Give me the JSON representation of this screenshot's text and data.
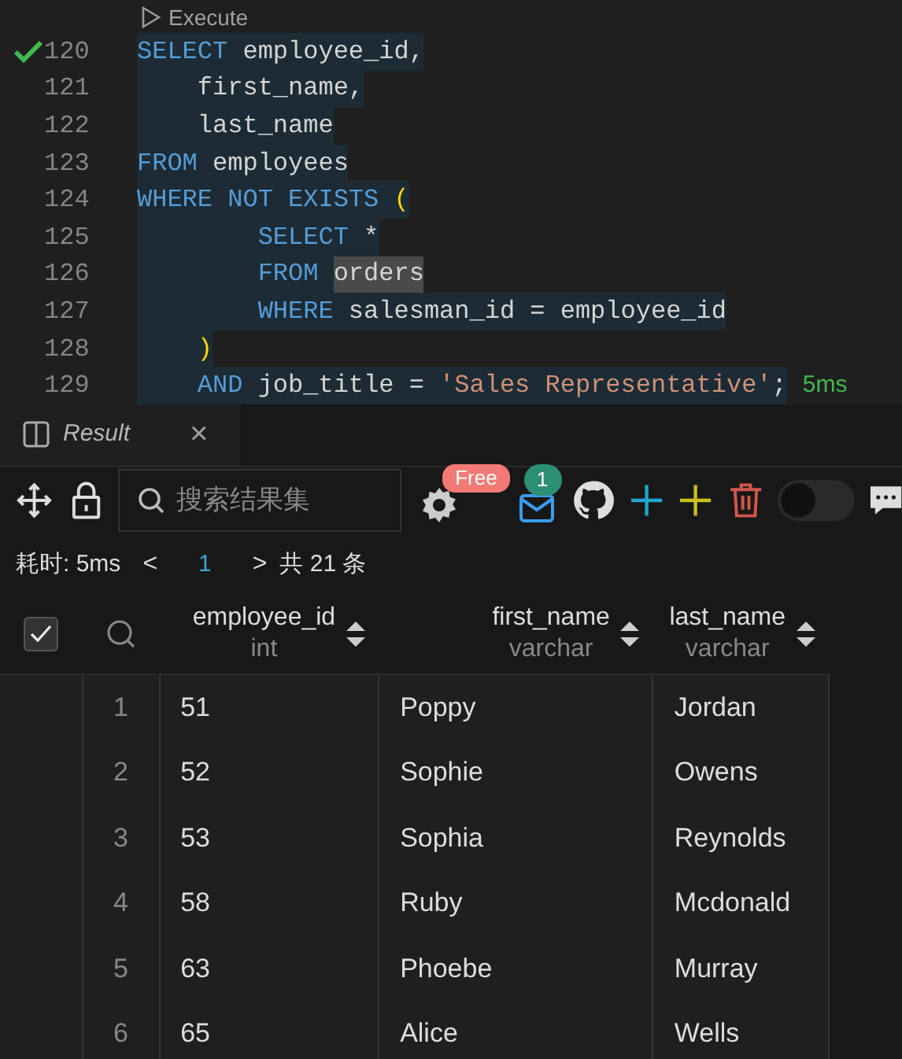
{
  "editor": {
    "codelens": "Execute",
    "lines": [
      {
        "number": "120",
        "passed": true,
        "tokens": [
          {
            "kind": "keyword",
            "text": "SELECT"
          },
          {
            "kind": "text",
            "text": " employee_id,"
          }
        ]
      },
      {
        "number": "121",
        "passed": false,
        "tokens": [
          {
            "kind": "text",
            "text": "    first_name,"
          }
        ]
      },
      {
        "number": "122",
        "passed": false,
        "tokens": [
          {
            "kind": "text",
            "text": "    last_name"
          }
        ]
      },
      {
        "number": "123",
        "passed": false,
        "tokens": [
          {
            "kind": "keyword",
            "text": "FROM"
          },
          {
            "kind": "text",
            "text": " employees"
          }
        ]
      },
      {
        "number": "124",
        "passed": false,
        "tokens": [
          {
            "kind": "keyword",
            "text": "WHERE NOT EXISTS"
          },
          {
            "kind": "paren",
            "text": " ("
          }
        ]
      },
      {
        "number": "125",
        "passed": false,
        "tokens": [
          {
            "kind": "keyword",
            "text": "        SELECT"
          },
          {
            "kind": "text",
            "text": " *"
          }
        ]
      },
      {
        "number": "126",
        "passed": false,
        "tokens": [
          {
            "kind": "keyword",
            "text": "        FROM "
          },
          {
            "kind": "match",
            "text": "orders"
          }
        ]
      },
      {
        "number": "127",
        "passed": false,
        "tokens": [
          {
            "kind": "keyword",
            "text": "        WHERE"
          },
          {
            "kind": "text",
            "text": " salesman_id = employee_id"
          }
        ]
      },
      {
        "number": "128",
        "passed": false,
        "tokens": [
          {
            "kind": "paren",
            "text": "    )"
          }
        ]
      },
      {
        "number": "129",
        "passed": false,
        "tokens": [
          {
            "kind": "keyword",
            "text": "    AND"
          },
          {
            "kind": "text",
            "text": " job_title = "
          },
          {
            "kind": "string",
            "text": "'Sales Representative'"
          },
          {
            "kind": "text",
            "text": ";"
          }
        ],
        "hint": "5ms"
      }
    ]
  },
  "panel": {
    "tabs": [
      {
        "label": "Result",
        "selected": true,
        "close": "×"
      }
    ],
    "search": {
      "placeholder": "搜索结果集"
    },
    "badges": {
      "settings": "Free",
      "mail": "1"
    },
    "toggle": {
      "on": false
    },
    "status": {
      "elapsed": "耗时: 5ms",
      "prev": "<",
      "page": "1",
      "next": ">",
      "total": "共 21 条"
    },
    "table": {
      "all_checked": true,
      "columns": [
        {
          "name": "employee_id",
          "type": "int"
        },
        {
          "name": "first_name",
          "type": "varchar"
        },
        {
          "name": "last_name",
          "type": "varchar"
        }
      ],
      "rows": [
        {
          "index": "1",
          "cells": [
            "51",
            "Poppy",
            "Jordan"
          ]
        },
        {
          "index": "2",
          "cells": [
            "52",
            "Sophie",
            "Owens"
          ]
        },
        {
          "index": "3",
          "cells": [
            "53",
            "Sophia",
            "Reynolds"
          ]
        },
        {
          "index": "4",
          "cells": [
            "58",
            "Ruby",
            "Mcdonald"
          ]
        },
        {
          "index": "5",
          "cells": [
            "63",
            "Phoebe",
            "Murray"
          ]
        },
        {
          "index": "6",
          "cells": [
            "65",
            "Alice",
            "Wells"
          ]
        }
      ]
    }
  }
}
